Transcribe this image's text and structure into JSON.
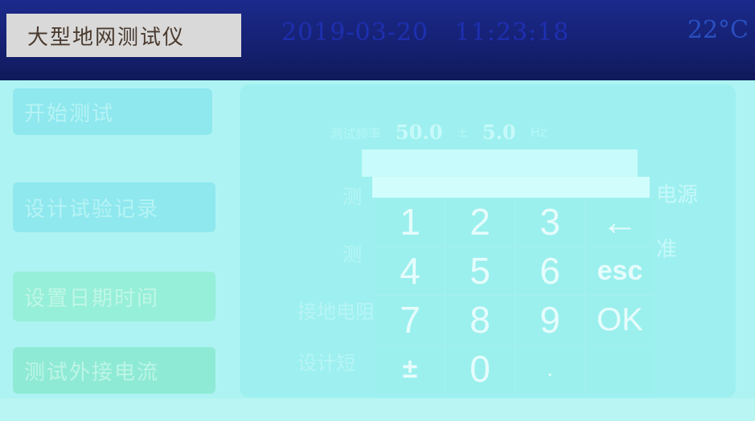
{
  "header": {
    "title": "大型地网测试仪",
    "date": "2019-03-20",
    "time": "11:23:18",
    "temperature": "22°C"
  },
  "left_menu": [
    {
      "label": "开始测试"
    },
    {
      "label": "设计试验记录"
    },
    {
      "label": "设置日期时间"
    },
    {
      "label": "测试外接电流"
    }
  ],
  "panel": {
    "freq_label": "测试频率",
    "freq_value": "50.0",
    "freq_sep": "±",
    "freq_delta": "5.0",
    "freq_unit": "Hz",
    "row_label_1": "测",
    "row_label_2": "测",
    "row_label_3": "接地电阻",
    "row_label_4": "设计短",
    "right_label_1": "电源",
    "right_label_2": "准"
  },
  "keypad": {
    "keys": [
      "1",
      "2",
      "3",
      "←",
      "4",
      "5",
      "6",
      "esc",
      "7",
      "8",
      "9",
      "OK",
      "±",
      "0",
      ".",
      ""
    ]
  }
}
